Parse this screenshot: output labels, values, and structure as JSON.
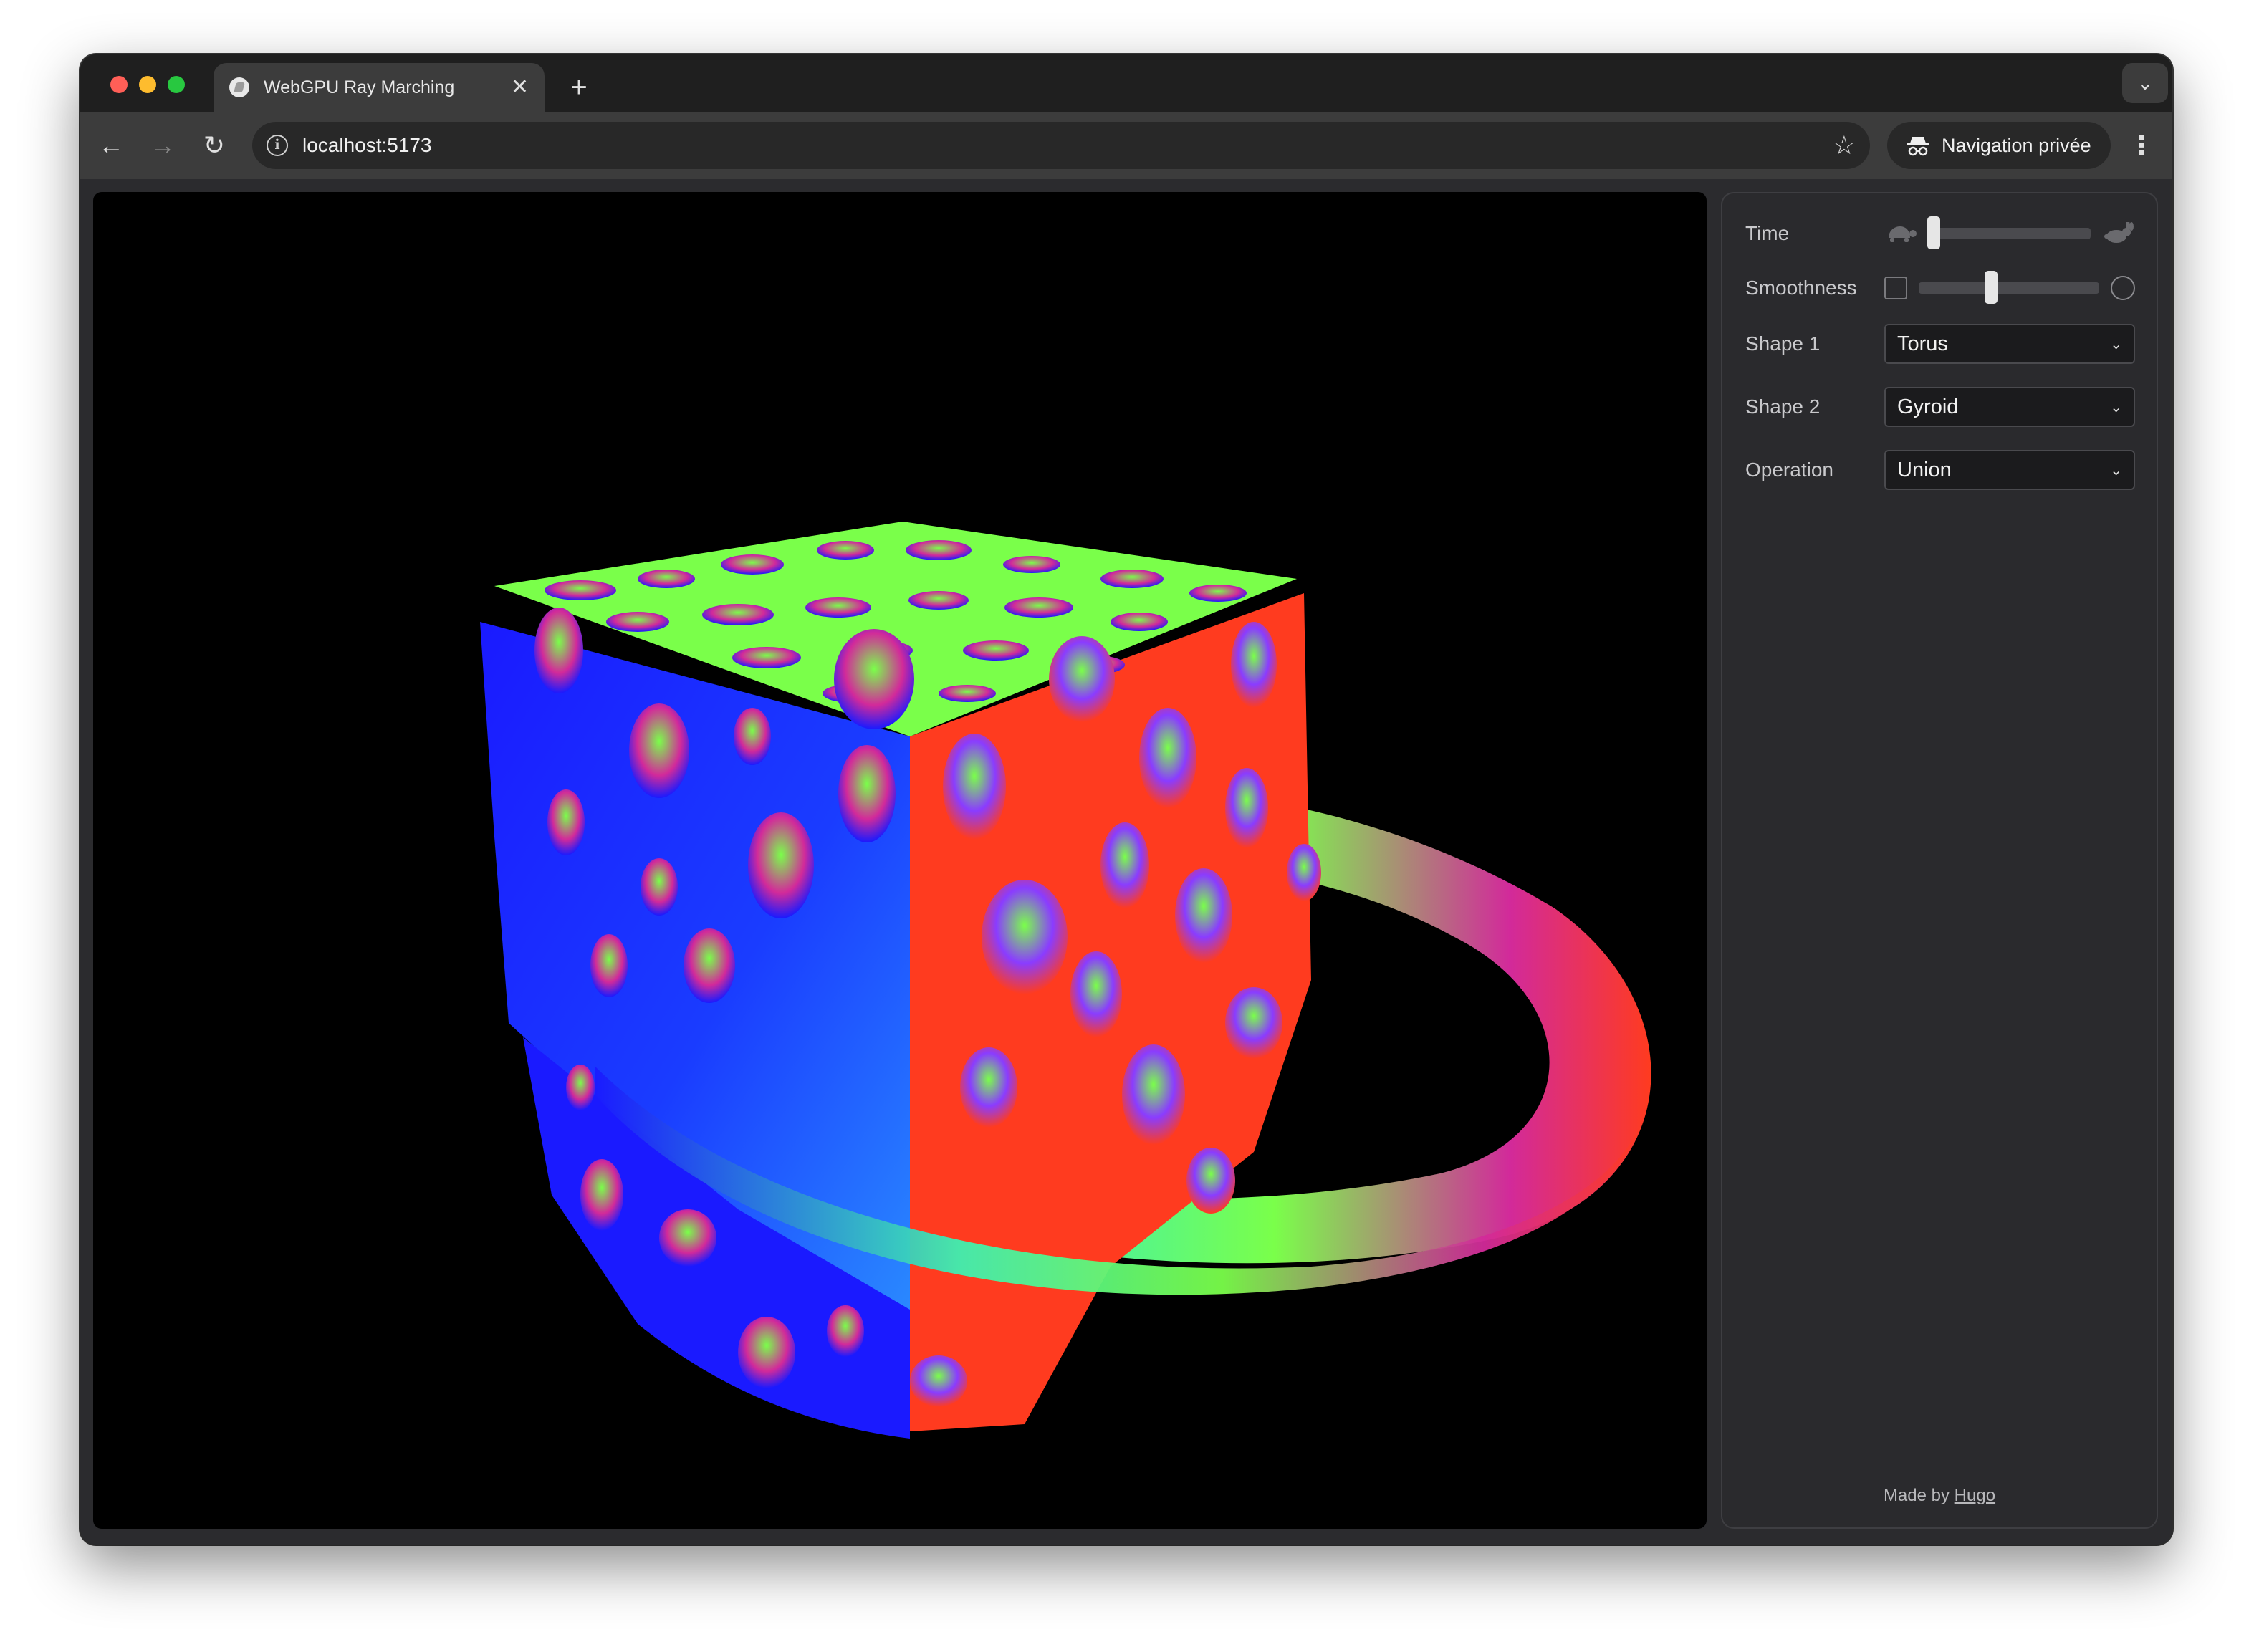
{
  "browser": {
    "tab_title": "WebGPU Ray Marching",
    "tab_close": "✕",
    "new_tab": "+",
    "tab_menu": "⌄",
    "back": "←",
    "forward": "→",
    "reload": "↻",
    "url": "localhost:5173",
    "bookmark": "☆",
    "incognito_label": "Navigation privée",
    "menu": "⋮"
  },
  "controls": {
    "time": {
      "label": "Time",
      "value": 0.03
    },
    "smoothness": {
      "label": "Smoothness",
      "value": 0.4,
      "checked": false
    },
    "shape1": {
      "label": "Shape 1",
      "value": "Torus"
    },
    "shape2": {
      "label": "Shape 2",
      "value": "Gyroid"
    },
    "operation": {
      "label": "Operation",
      "value": "Union"
    }
  },
  "footer": {
    "prefix": "Made by",
    "author": "Hugo"
  },
  "icons": {
    "info": "info-icon",
    "star": "star-icon",
    "incognito": "incognito-icon",
    "turtle": "turtle-icon",
    "rabbit": "rabbit-icon",
    "chevron": "chevron-down-icon"
  },
  "colors": {
    "red": "#ff3b1f",
    "green": "#7aff4a",
    "blue": "#1a1aff",
    "magenta": "#d22a9a"
  }
}
